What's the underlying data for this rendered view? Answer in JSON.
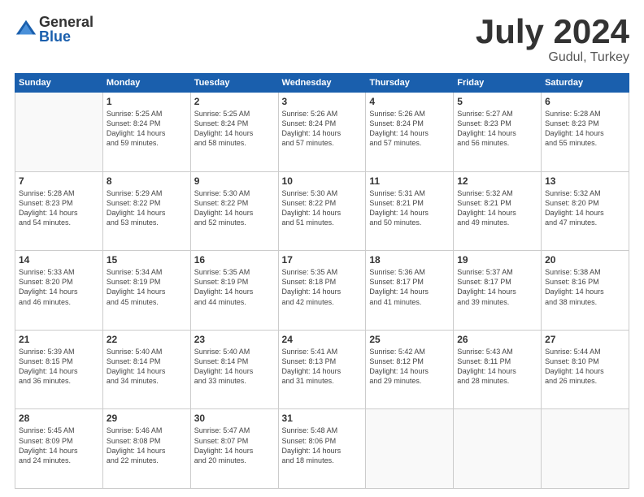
{
  "logo": {
    "general": "General",
    "blue": "Blue"
  },
  "header": {
    "month": "July 2024",
    "location": "Gudul, Turkey"
  },
  "days": [
    "Sunday",
    "Monday",
    "Tuesday",
    "Wednesday",
    "Thursday",
    "Friday",
    "Saturday"
  ],
  "weeks": [
    [
      {
        "day": "",
        "info": ""
      },
      {
        "day": "1",
        "info": "Sunrise: 5:25 AM\nSunset: 8:24 PM\nDaylight: 14 hours\nand 59 minutes."
      },
      {
        "day": "2",
        "info": "Sunrise: 5:25 AM\nSunset: 8:24 PM\nDaylight: 14 hours\nand 58 minutes."
      },
      {
        "day": "3",
        "info": "Sunrise: 5:26 AM\nSunset: 8:24 PM\nDaylight: 14 hours\nand 57 minutes."
      },
      {
        "day": "4",
        "info": "Sunrise: 5:26 AM\nSunset: 8:24 PM\nDaylight: 14 hours\nand 57 minutes."
      },
      {
        "day": "5",
        "info": "Sunrise: 5:27 AM\nSunset: 8:23 PM\nDaylight: 14 hours\nand 56 minutes."
      },
      {
        "day": "6",
        "info": "Sunrise: 5:28 AM\nSunset: 8:23 PM\nDaylight: 14 hours\nand 55 minutes."
      }
    ],
    [
      {
        "day": "7",
        "info": "Sunrise: 5:28 AM\nSunset: 8:23 PM\nDaylight: 14 hours\nand 54 minutes."
      },
      {
        "day": "8",
        "info": "Sunrise: 5:29 AM\nSunset: 8:22 PM\nDaylight: 14 hours\nand 53 minutes."
      },
      {
        "day": "9",
        "info": "Sunrise: 5:30 AM\nSunset: 8:22 PM\nDaylight: 14 hours\nand 52 minutes."
      },
      {
        "day": "10",
        "info": "Sunrise: 5:30 AM\nSunset: 8:22 PM\nDaylight: 14 hours\nand 51 minutes."
      },
      {
        "day": "11",
        "info": "Sunrise: 5:31 AM\nSunset: 8:21 PM\nDaylight: 14 hours\nand 50 minutes."
      },
      {
        "day": "12",
        "info": "Sunrise: 5:32 AM\nSunset: 8:21 PM\nDaylight: 14 hours\nand 49 minutes."
      },
      {
        "day": "13",
        "info": "Sunrise: 5:32 AM\nSunset: 8:20 PM\nDaylight: 14 hours\nand 47 minutes."
      }
    ],
    [
      {
        "day": "14",
        "info": "Sunrise: 5:33 AM\nSunset: 8:20 PM\nDaylight: 14 hours\nand 46 minutes."
      },
      {
        "day": "15",
        "info": "Sunrise: 5:34 AM\nSunset: 8:19 PM\nDaylight: 14 hours\nand 45 minutes."
      },
      {
        "day": "16",
        "info": "Sunrise: 5:35 AM\nSunset: 8:19 PM\nDaylight: 14 hours\nand 44 minutes."
      },
      {
        "day": "17",
        "info": "Sunrise: 5:35 AM\nSunset: 8:18 PM\nDaylight: 14 hours\nand 42 minutes."
      },
      {
        "day": "18",
        "info": "Sunrise: 5:36 AM\nSunset: 8:17 PM\nDaylight: 14 hours\nand 41 minutes."
      },
      {
        "day": "19",
        "info": "Sunrise: 5:37 AM\nSunset: 8:17 PM\nDaylight: 14 hours\nand 39 minutes."
      },
      {
        "day": "20",
        "info": "Sunrise: 5:38 AM\nSunset: 8:16 PM\nDaylight: 14 hours\nand 38 minutes."
      }
    ],
    [
      {
        "day": "21",
        "info": "Sunrise: 5:39 AM\nSunset: 8:15 PM\nDaylight: 14 hours\nand 36 minutes."
      },
      {
        "day": "22",
        "info": "Sunrise: 5:40 AM\nSunset: 8:14 PM\nDaylight: 14 hours\nand 34 minutes."
      },
      {
        "day": "23",
        "info": "Sunrise: 5:40 AM\nSunset: 8:14 PM\nDaylight: 14 hours\nand 33 minutes."
      },
      {
        "day": "24",
        "info": "Sunrise: 5:41 AM\nSunset: 8:13 PM\nDaylight: 14 hours\nand 31 minutes."
      },
      {
        "day": "25",
        "info": "Sunrise: 5:42 AM\nSunset: 8:12 PM\nDaylight: 14 hours\nand 29 minutes."
      },
      {
        "day": "26",
        "info": "Sunrise: 5:43 AM\nSunset: 8:11 PM\nDaylight: 14 hours\nand 28 minutes."
      },
      {
        "day": "27",
        "info": "Sunrise: 5:44 AM\nSunset: 8:10 PM\nDaylight: 14 hours\nand 26 minutes."
      }
    ],
    [
      {
        "day": "28",
        "info": "Sunrise: 5:45 AM\nSunset: 8:09 PM\nDaylight: 14 hours\nand 24 minutes."
      },
      {
        "day": "29",
        "info": "Sunrise: 5:46 AM\nSunset: 8:08 PM\nDaylight: 14 hours\nand 22 minutes."
      },
      {
        "day": "30",
        "info": "Sunrise: 5:47 AM\nSunset: 8:07 PM\nDaylight: 14 hours\nand 20 minutes."
      },
      {
        "day": "31",
        "info": "Sunrise: 5:48 AM\nSunset: 8:06 PM\nDaylight: 14 hours\nand 18 minutes."
      },
      {
        "day": "",
        "info": ""
      },
      {
        "day": "",
        "info": ""
      },
      {
        "day": "",
        "info": ""
      }
    ]
  ]
}
